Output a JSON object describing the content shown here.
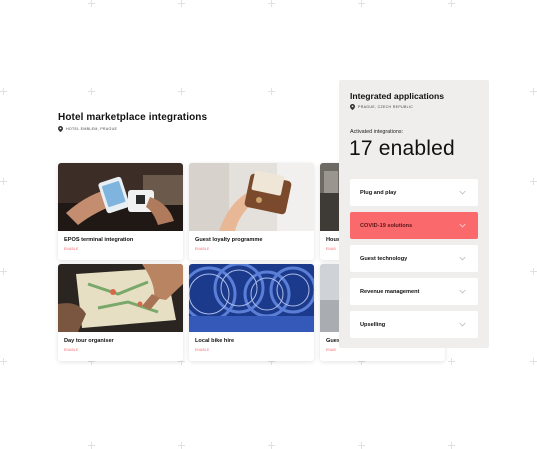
{
  "page": {
    "title": "Hotel marketplace integrations",
    "location": "HOTEL EMBLEM, PRAGUE"
  },
  "cards": [
    {
      "title": "EPOS terminal integration",
      "status": "ENABLE",
      "image": "card-payment-terminal"
    },
    {
      "title": "Guest loyalty programme",
      "status": "ENABLE",
      "image": "wallet-cards"
    },
    {
      "title": "Hous",
      "status": "ENAB",
      "image": "room-interior"
    },
    {
      "title": "Day tour organiser",
      "status": "ENABLE",
      "image": "map-pointing"
    },
    {
      "title": "Local bike hire",
      "status": "ENABLE",
      "image": "blue-bikes"
    },
    {
      "title": "Gues",
      "status": "ENAB",
      "image": "room-interior"
    }
  ],
  "panel": {
    "title": "Integrated applications",
    "location": "PRAGUE, CZECH REPUBLIC",
    "activated_label": "Activated integrations:",
    "count_text": "17 enabled",
    "items": [
      {
        "label": "Plug and play",
        "active": false
      },
      {
        "label": "COVID-19 solutions",
        "active": true
      },
      {
        "label": "Guest technology",
        "active": false
      },
      {
        "label": "Revenue management",
        "active": false
      },
      {
        "label": "Upselling",
        "active": false
      }
    ]
  },
  "colors": {
    "accent": "#fa6a6c",
    "status_text": "#f26065",
    "panel_bg": "#efeeec"
  }
}
